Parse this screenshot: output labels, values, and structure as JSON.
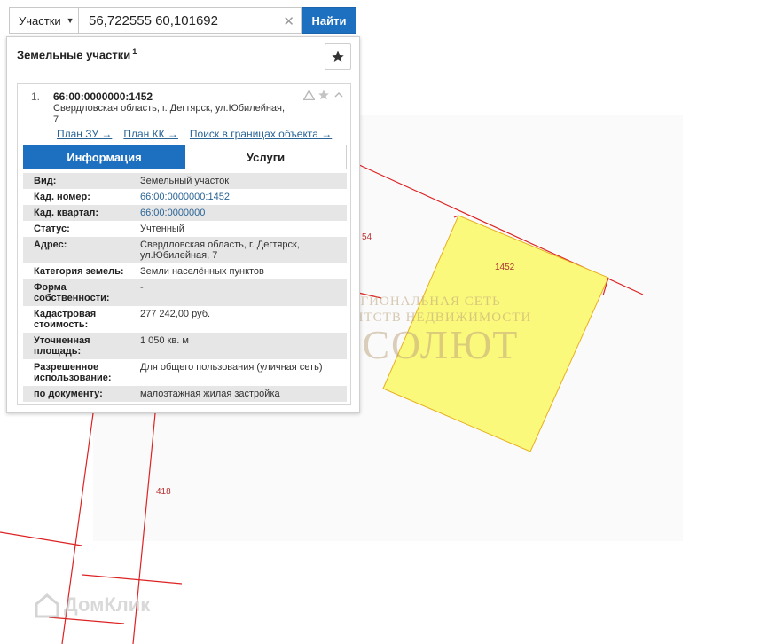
{
  "search": {
    "type_label": "Участки",
    "query": "56,722555 60,101692",
    "button_label": "Найти"
  },
  "panel": {
    "title": "Земельные участки",
    "count": "1"
  },
  "card": {
    "index": "1.",
    "cadastral": "66:00:0000000:1452",
    "address": "Свердловская область, г. Дегтярск, ул.Юбилейная, 7",
    "links": [
      {
        "label": "План ЗУ →"
      },
      {
        "label": "План КК →"
      },
      {
        "label": "Поиск в границах объекта →"
      }
    ],
    "tabs": [
      {
        "label": "Информация",
        "active": true
      },
      {
        "label": "Услуги",
        "active": false
      }
    ],
    "rows": [
      {
        "key": "Вид:",
        "value": "Земельный участок"
      },
      {
        "key": "Кад. номер:",
        "value": "66:00:0000000:1452"
      },
      {
        "key": "Кад. квартал:",
        "value": "66:00:0000000"
      },
      {
        "key": "Статус:",
        "value": "Учтенный"
      },
      {
        "key": "Адрес:",
        "value": "Свердловская область, г. Дегтярск, ул.Юбилейная, 7"
      },
      {
        "key": "Категория земель:",
        "value": "Земли населённых пунктов"
      },
      {
        "key": "Форма собственности:",
        "value": "-"
      },
      {
        "key": "Кадастровая стоимость:",
        "value": "277 242,00 руб."
      },
      {
        "key": "Уточненная площадь:",
        "value": "1 050 кв. м"
      },
      {
        "key": "Разрешенное использование:",
        "value": "Для общего пользования (уличная сеть)"
      },
      {
        "key": "по документу:",
        "value": "малоэтажная жилая застройка"
      }
    ]
  },
  "map": {
    "parcel_label": "1452",
    "label_54": "54",
    "label_418": "418",
    "parcel_color": "#fbf97c",
    "boundary_color": "#dd2222"
  },
  "watermark": {
    "line1": "РЕГИОНАЛЬНАЯ СЕТЬ",
    "line2": "АГЕНТСТВ НЕДВИЖИМОСТИ",
    "brand": "АБСОЛЮТ"
  },
  "domclick": {
    "label": "ДомКлик"
  },
  "colors": {
    "accent": "#1d6fc0",
    "link": "#2a6496"
  },
  "icons": [
    "caret-down-icon",
    "clear-icon",
    "star-icon",
    "warning-icon",
    "chevron-up-icon"
  ]
}
